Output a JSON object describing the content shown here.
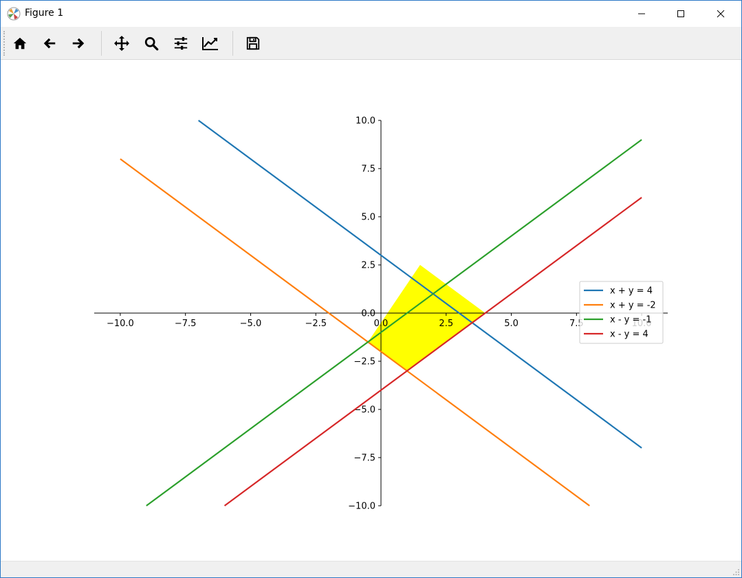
{
  "window": {
    "title": "Figure 1"
  },
  "toolbar": {
    "buttons": [
      {
        "name": "home-icon"
      },
      {
        "name": "back-arrow-icon"
      },
      {
        "name": "forward-arrow-icon"
      },
      {
        "name": "pan-icon"
      },
      {
        "name": "zoom-icon"
      },
      {
        "name": "configure-subplots-icon"
      },
      {
        "name": "edit-axis-icon"
      },
      {
        "name": "save-icon"
      }
    ]
  },
  "chart_data": {
    "type": "line",
    "title": "",
    "xlabel": "",
    "ylabel": "",
    "xlim": [
      -11,
      11
    ],
    "ylim": [
      -10,
      10
    ],
    "xticks": [
      "−10.0",
      "−7.5",
      "−5.0",
      "−2.5",
      "0.0",
      "2.5",
      "5.0",
      "7.5",
      "10.0"
    ],
    "xtick_values": [
      -10,
      -7.5,
      -5,
      -2.5,
      0,
      2.5,
      5,
      7.5,
      10
    ],
    "yticks": [
      "10.0",
      "7.5",
      "5.0",
      "2.5",
      "0.0",
      "−2.5",
      "−5.0",
      "−7.5",
      "−10.0"
    ],
    "ytick_values": [
      10,
      7.5,
      5,
      2.5,
      0,
      -2.5,
      -5,
      -7.5,
      -10
    ],
    "series": [
      {
        "name": "x + y = 4",
        "color": "#1f77b4",
        "x": [
          -7,
          10
        ],
        "y": [
          10,
          -7
        ]
      },
      {
        "name": "x + y = -2",
        "color": "#ff7f0e",
        "x": [
          -10,
          8
        ],
        "y": [
          8,
          -10
        ]
      },
      {
        "name": "x - y = -1",
        "color": "#2ca02c",
        "x": [
          -9,
          10
        ],
        "y": [
          -10,
          9
        ]
      },
      {
        "name": "x - y = 4",
        "color": "#d62728",
        "x": [
          -6,
          10
        ],
        "y": [
          -10,
          6
        ]
      }
    ],
    "fill_region": {
      "color": "#ffff00",
      "vertices": [
        [
          -0.5,
          -1.5
        ],
        [
          1.5,
          2.5
        ],
        [
          4,
          0
        ],
        [
          1,
          -3
        ]
      ]
    },
    "grid": false,
    "spines": "centered",
    "legend": {
      "position": "center-right",
      "entries": [
        "x + y = 4",
        "x + y = -2",
        "x - y = -1",
        "x - y = 4"
      ]
    }
  }
}
